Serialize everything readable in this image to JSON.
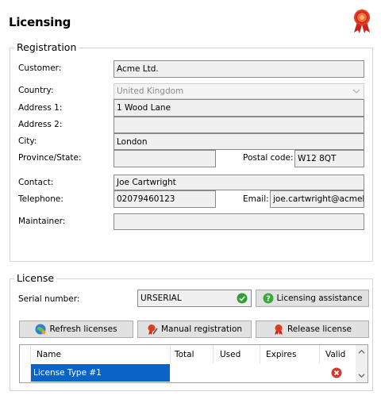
{
  "page": {
    "title": "Licensing",
    "ribbon_icon": "award-ribbon-icon"
  },
  "registration": {
    "group_title": "Registration",
    "customer": {
      "label": "Customer:",
      "value": "Acme Ltd."
    },
    "country": {
      "label": "Country:",
      "value": "United Kingdom"
    },
    "address1": {
      "label": "Address 1:",
      "value": "1 Wood Lane"
    },
    "address2": {
      "label": "Address 2:",
      "value": ""
    },
    "city": {
      "label": "City:",
      "value": "London"
    },
    "province": {
      "label": "Province/State:",
      "value": ""
    },
    "postal": {
      "label": "Postal code:",
      "value": "W12 8QT"
    },
    "contact": {
      "label": "Contact:",
      "value": "Joe Cartwright"
    },
    "telephone": {
      "label": "Telephone:",
      "value": "02079460123"
    },
    "email": {
      "label": "Email:",
      "value": "joe.cartwright@acmel"
    },
    "maintainer": {
      "label": "Maintainer:",
      "value": ""
    }
  },
  "license": {
    "group_title": "License",
    "serial": {
      "label": "Serial number:",
      "value": "URSERIAL"
    },
    "assistance_label": "Licensing assistance",
    "refresh_label": "Refresh licenses",
    "manual_label": "Manual registration",
    "release_label": "Release license",
    "table": {
      "columns": [
        "Name",
        "Total",
        "Used",
        "Expires",
        "Valid"
      ],
      "rows": [
        {
          "name": "License Type #1",
          "total": "",
          "used": "",
          "expires": "",
          "valid": "invalid"
        }
      ]
    }
  },
  "colors": {
    "valid_green": "#2ea02e",
    "invalid_red": "#d23a2a",
    "selection_blue": "#0a64c8"
  }
}
